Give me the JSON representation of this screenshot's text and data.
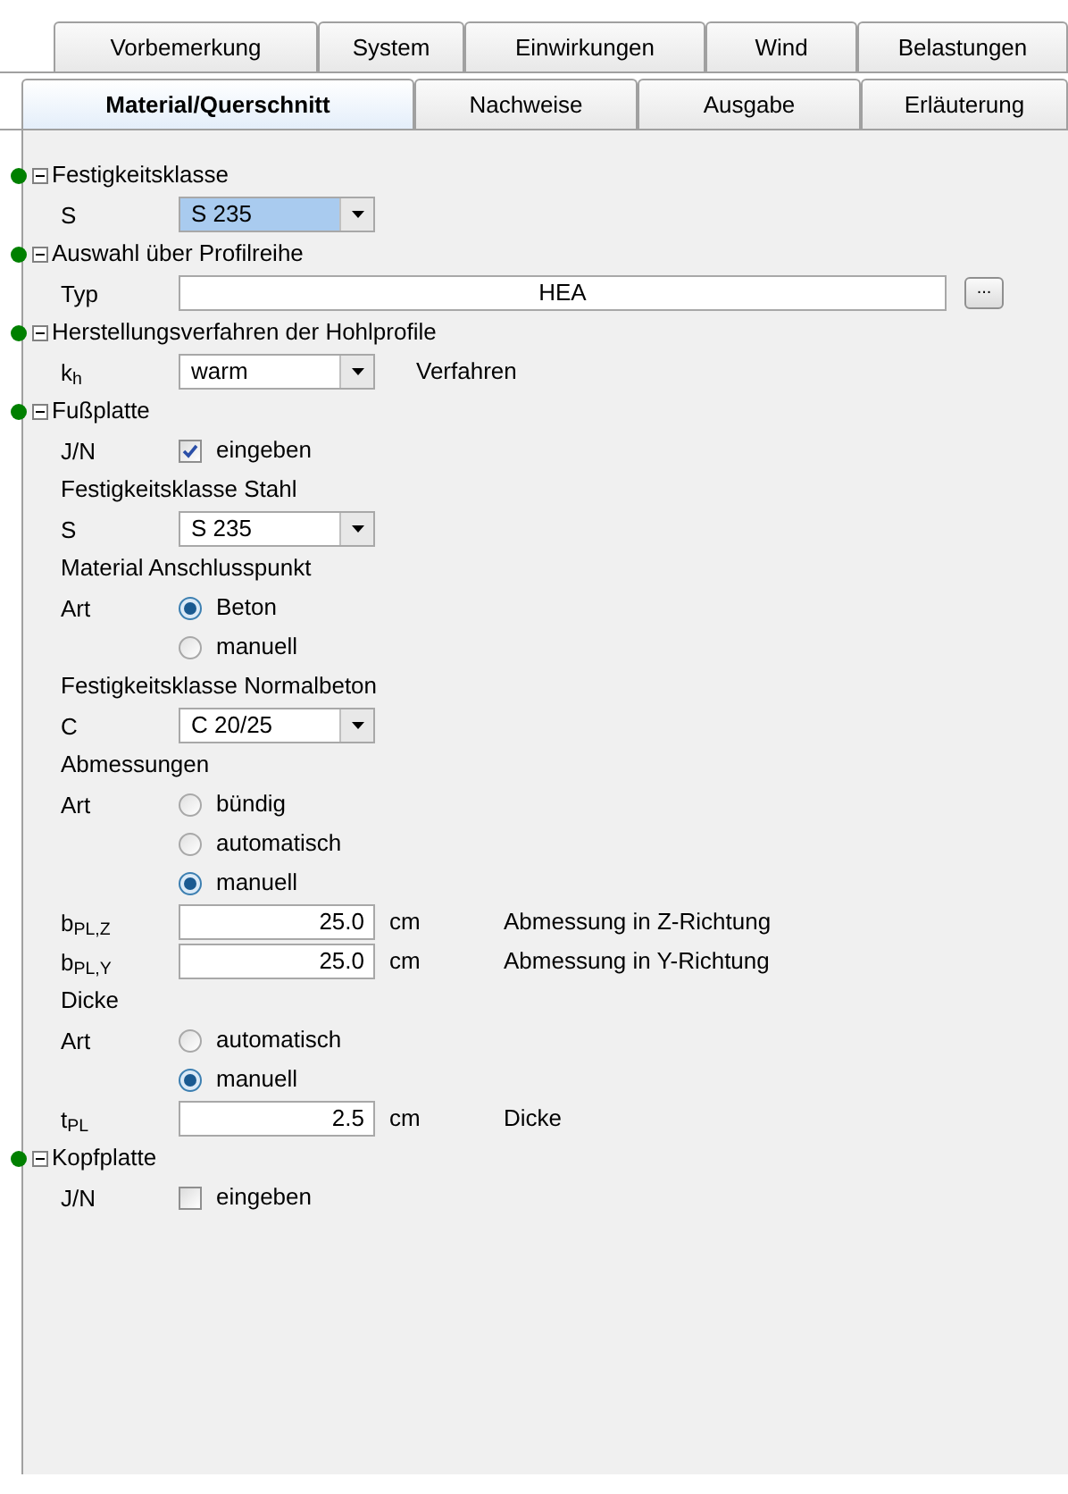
{
  "tab_rows": [
    [
      {
        "label": "Vorbemerkung",
        "selected": false
      },
      {
        "label": "System",
        "selected": false
      },
      {
        "label": "Einwirkungen",
        "selected": false
      },
      {
        "label": "Wind",
        "selected": false
      },
      {
        "label": "Belastungen",
        "selected": false
      }
    ],
    [
      {
        "label": "Material/Querschnitt",
        "selected": true
      },
      {
        "label": "Nachweise",
        "selected": false
      },
      {
        "label": "Ausgabe",
        "selected": false
      },
      {
        "label": "Erläuterung",
        "selected": false
      }
    ]
  ],
  "rows": [
    {
      "kind": "section",
      "label": "Festigkeitsklasse",
      "expanded": true,
      "color": "#008000"
    },
    {
      "kind": "select",
      "label": "S",
      "value": "S 235",
      "focused": true
    },
    {
      "kind": "section",
      "label": "Auswahl über Profilreihe",
      "expanded": true,
      "color": "#008000"
    },
    {
      "kind": "text",
      "label": "Typ",
      "value": "HEA",
      "button": "..."
    },
    {
      "kind": "section",
      "label": "Herstellungsverfahren der Hohlprofile",
      "expanded": true,
      "color": "#008000"
    },
    {
      "kind": "select",
      "label": "k$_{h}$",
      "value": "warm",
      "focused": false,
      "note": "Verfahren"
    },
    {
      "kind": "section",
      "label": "Fußplatte",
      "expanded": true,
      "color": "#008000"
    },
    {
      "kind": "checkbox",
      "label": "J/N",
      "text": "eingeben",
      "checked": true
    },
    {
      "kind": "heading",
      "label": "Festigkeitsklasse Stahl"
    },
    {
      "kind": "select",
      "label": "S",
      "value": "S 235",
      "focused": false
    },
    {
      "kind": "heading",
      "label": "Material Anschlusspunkt"
    },
    {
      "kind": "radio",
      "label": "Art",
      "text": "Beton",
      "selected": true
    },
    {
      "kind": "radio",
      "text": "manuell",
      "selected": false
    },
    {
      "kind": "heading",
      "label": "Festigkeitsklasse Normalbeton"
    },
    {
      "kind": "select",
      "label": "C",
      "value": "C 20/25",
      "focused": false
    },
    {
      "kind": "heading",
      "label": "Abmessungen"
    },
    {
      "kind": "radio",
      "label": "Art",
      "text": "bündig",
      "selected": false
    },
    {
      "kind": "radio",
      "text": "automatisch",
      "selected": false
    },
    {
      "kind": "radio",
      "text": "manuell",
      "selected": true
    },
    {
      "kind": "number",
      "label": "b$_{PL,Z}$",
      "value": "25.0",
      "unit": "cm",
      "note": "Abmessung in Z-Richtung"
    },
    {
      "kind": "number",
      "label": "b$_{PL,Y}$",
      "value": "25.0",
      "unit": "cm",
      "note": "Abmessung in Y-Richtung"
    },
    {
      "kind": "heading",
      "label": "Dicke"
    },
    {
      "kind": "radio",
      "label": "Art",
      "text": "automatisch",
      "selected": false
    },
    {
      "kind": "radio",
      "text": "manuell",
      "selected": true
    },
    {
      "kind": "number",
      "label": "t$_{PL}$",
      "value": "2.5",
      "unit": "cm",
      "note": "Dicke"
    },
    {
      "kind": "section",
      "label": "Kopfplatte",
      "expanded": true,
      "color": "#008000"
    },
    {
      "kind": "checkbox",
      "label": "J/N",
      "text": "eingeben",
      "checked": false
    }
  ]
}
